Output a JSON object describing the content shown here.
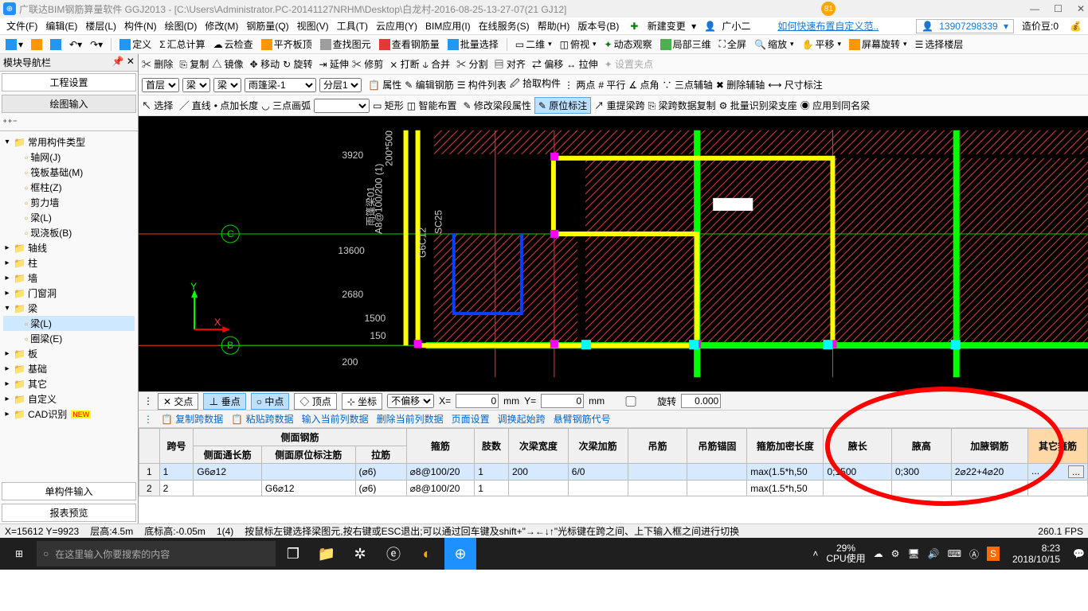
{
  "title": "广联达BIM钢筋算量软件 GGJ2013 - [C:\\Users\\Administrator.PC-20141127NRHM\\Desktop\\白龙村-2016-08-25-13-27-07(21       GJ12]",
  "title_badge": "81",
  "menus": [
    "文件(F)",
    "编辑(E)",
    "楼层(L)",
    "构件(N)",
    "绘图(D)",
    "修改(M)",
    "钢筋量(Q)",
    "视图(V)",
    "工具(T)",
    "云应用(Y)",
    "BIM应用(I)",
    "在线服务(S)",
    "帮助(H)",
    "版本号(B)"
  ],
  "menu_new": "新建变更",
  "menu_user": "广小二",
  "menu_link": "如何快速布置自定义范..",
  "menu_phone": "13907298339",
  "menu_coin": "造价豆:0",
  "tb1": [
    "定义",
    "汇总计算",
    "云检查",
    "平齐板顶",
    "查找图元",
    "查看钢筋量",
    "批量选择",
    "二维",
    "俯视",
    "动态观察",
    "局部三维",
    "全屏",
    "缩放",
    "平移",
    "屏幕旋转",
    "选择楼层"
  ],
  "tb2": [
    "删除",
    "复制",
    "镜像",
    "移动",
    "旋转",
    "延伸",
    "修剪",
    "打断",
    "合并",
    "分割",
    "对齐",
    "偏移",
    "拉伸",
    "设置夹点"
  ],
  "dropdowns": {
    "floor": "首层",
    "cat": "梁",
    "sub": "梁",
    "member": "雨篷梁-1",
    "level": "分层1"
  },
  "tb3": [
    "属性",
    "编辑钢筋",
    "构件列表",
    "拾取构件",
    "两点",
    "平行",
    "点角",
    "三点辅轴",
    "删除辅轴",
    "尺寸标注"
  ],
  "tb4": [
    "选择",
    "直线",
    "点加长度",
    "三点画弧",
    "矩形",
    "智能布置",
    "修改梁段属性",
    "原位标注",
    "重提梁跨",
    "梁跨数据复制",
    "批量识别梁支座",
    "应用到同名梁"
  ],
  "panel_title": "模块导航栏",
  "tabs": {
    "t1": "工程设置",
    "t2": "绘图输入"
  },
  "tree": [
    {
      "l": 0,
      "e": "▾",
      "t": "常用构件类型"
    },
    {
      "l": 1,
      "t": "轴网(J)"
    },
    {
      "l": 1,
      "t": "筏板基础(M)"
    },
    {
      "l": 1,
      "t": "框柱(Z)"
    },
    {
      "l": 1,
      "t": "剪力墙"
    },
    {
      "l": 1,
      "t": "梁(L)"
    },
    {
      "l": 1,
      "t": "现浇板(B)"
    },
    {
      "l": 0,
      "e": "▸",
      "t": "轴线"
    },
    {
      "l": 0,
      "e": "▸",
      "t": "柱"
    },
    {
      "l": 0,
      "e": "▸",
      "t": "墙"
    },
    {
      "l": 0,
      "e": "▸",
      "t": "门窗洞"
    },
    {
      "l": 0,
      "e": "▾",
      "t": "梁"
    },
    {
      "l": 1,
      "t": "梁(L)",
      "sel": true
    },
    {
      "l": 1,
      "t": "圈梁(E)"
    },
    {
      "l": 0,
      "e": "▸",
      "t": "板"
    },
    {
      "l": 0,
      "e": "▸",
      "t": "基础"
    },
    {
      "l": 0,
      "e": "▸",
      "t": "其它"
    },
    {
      "l": 0,
      "e": "▸",
      "t": "自定义"
    },
    {
      "l": 0,
      "e": "▸",
      "t": "CAD识别",
      "new": true
    }
  ],
  "bottom_tabs": {
    "b1": "单构件输入",
    "b2": "报表预览"
  },
  "canvas_labels": {
    "c": "C",
    "b": "B",
    "y": "Y",
    "x": "X",
    "d1": "3920",
    "d2": "13600",
    "d3": "2680",
    "d4": "1500",
    "d5": "150",
    "d6": "200",
    "d7": "200*500",
    "d8": "A8@100/200 (1)",
    "d9": "SC25",
    "d10": "G6C12",
    "d11": "雨篷梁01"
  },
  "coord": {
    "jd": "交点",
    "cd": "垂点",
    "zd": "中点",
    "dd": "顶点",
    "zb": "坐标",
    "offset": "不偏移",
    "x": "0",
    "y": "0",
    "mm": "mm",
    "rot": "旋转",
    "rotval": "0.000",
    "xlbl": "X=",
    "ylbl": "Y="
  },
  "tabletools": [
    "复制跨数据",
    "粘贴跨数据",
    "输入当前列数据",
    "删除当前列数据",
    "页面设置",
    "调换起始跨",
    "悬臂钢筋代号"
  ],
  "headers_top": {
    "kh": "跨号",
    "cm": "侧面钢筋",
    "gj": "箍筋",
    "zs": "肢数",
    "ckd": "次梁宽度",
    "cjj": "次梁加筋",
    "dj": "吊筋",
    "djmg": "吊筋锚固",
    "gjmcd": "箍筋加密长度",
    "fc": "腋长",
    "fg": "腋高",
    "jfgj": "加腋钢筋",
    "qtgj": "其它箍筋"
  },
  "headers_sub": {
    "cmtc": "侧面通长筋",
    "cmyw": "侧面原位标注筋",
    "lj": "拉筋"
  },
  "rows": [
    {
      "n": "1",
      "kh": "1",
      "cmtc": "G6⌀12",
      "cmyw": "",
      "lj": "(⌀6)",
      "gj": "⌀8@100/20",
      "zs": "1",
      "ckd": "200",
      "cjj": "6/0",
      "dj": "",
      "djmg": "",
      "gjmcd": "max(1.5*h,50",
      "fc": "0;1500",
      "fg": "0;300",
      "jfgj": "2⌀22+4⌀20",
      "qtgj": "..."
    },
    {
      "n": "2",
      "kh": "2",
      "cmtc": "",
      "cmyw": "G6⌀12",
      "lj": "(⌀6)",
      "gj": "⌀8@100/20",
      "zs": "1",
      "ckd": "",
      "cjj": "",
      "dj": "",
      "djmg": "",
      "gjmcd": "max(1.5*h,50",
      "fc": "",
      "fg": "",
      "jfgj": "",
      "qtgj": ""
    }
  ],
  "status": {
    "xy": "X=15612 Y=9923",
    "lh": "层高:4.5m",
    "dbg": "底标高:-0.05m",
    "sp": "1(4)",
    "hint": "按鼠标左键选择梁图元,按右键或ESC退出;可以通过回车键及shift+\"→←↓↑\"光标键在跨之间、上下输入框之间进行切换",
    "fps": "260.1 FPS"
  },
  "taskbar": {
    "search": "在这里输入你要搜索的内容",
    "cpu_pct": "29%",
    "cpu": "CPU使用",
    "time": "8:23",
    "date": "2018/10/15"
  }
}
